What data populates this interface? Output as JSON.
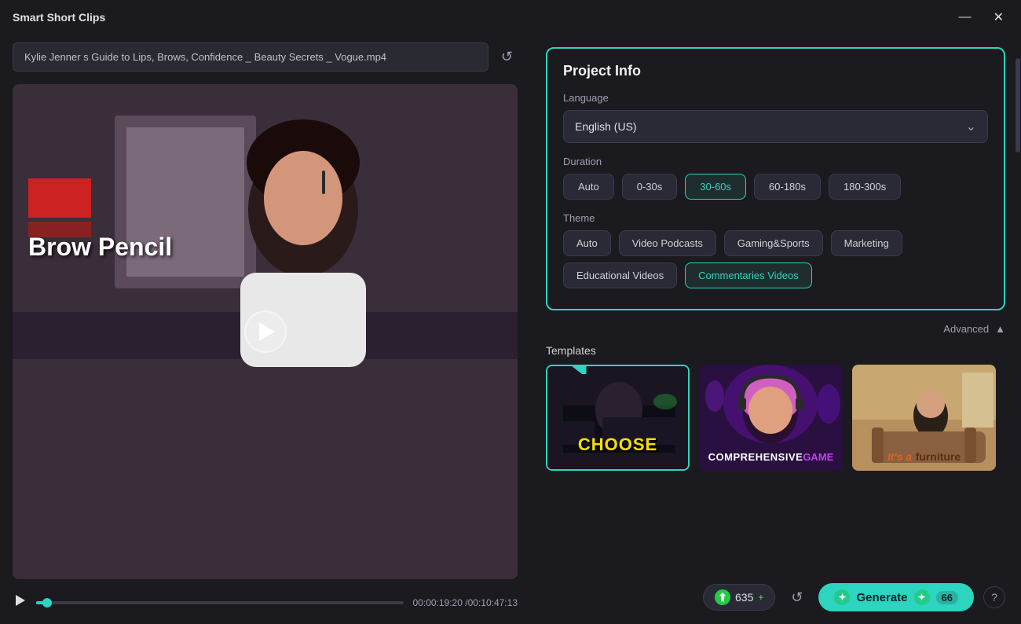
{
  "app": {
    "title": "Smart Short Clips"
  },
  "titlebar": {
    "minimize_label": "—",
    "close_label": "✕"
  },
  "file": {
    "filename": "Kylie Jenner s Guide to Lips, Brows, Confidence _ Beauty Secrets _ Vogue.mp4",
    "reload_icon": "↺"
  },
  "video": {
    "overlay_text": "Brow Pencil",
    "current_time": "00:00:19:20",
    "total_time": "/00:10:47:13",
    "time_separator": "/"
  },
  "project_info": {
    "title": "Project Info",
    "language_label": "Language",
    "language_value": "English (US)",
    "duration_label": "Duration",
    "duration_options": [
      "Auto",
      "0-30s",
      "30-60s",
      "60-180s",
      "180-300s"
    ],
    "duration_active": "30-60s",
    "theme_label": "Theme",
    "theme_options": [
      "Auto",
      "Video Podcasts",
      "Gaming&Sports",
      "Marketing"
    ],
    "theme_row2": [
      "Educational Videos",
      "Commentaries Videos"
    ],
    "theme_active": "Commentaries Videos",
    "advanced_label": "Advanced",
    "advanced_icon": "▲"
  },
  "templates": {
    "label": "Templates",
    "items": [
      {
        "id": "template-1",
        "caption": "CHOOSE",
        "caption_style": "yellow",
        "selected": true
      },
      {
        "id": "template-2",
        "caption_main": "COMPREHENSIVE",
        "caption_highlight": "GAME",
        "selected": false
      },
      {
        "id": "template-3",
        "caption_its": "It's a",
        "caption_word": "furniture",
        "selected": false
      }
    ]
  },
  "bottom_bar": {
    "credits_value": "635",
    "credits_plus": "+",
    "reload_icon": "↺",
    "generate_label": "Generate",
    "generate_count": "66",
    "help_icon": "?"
  }
}
